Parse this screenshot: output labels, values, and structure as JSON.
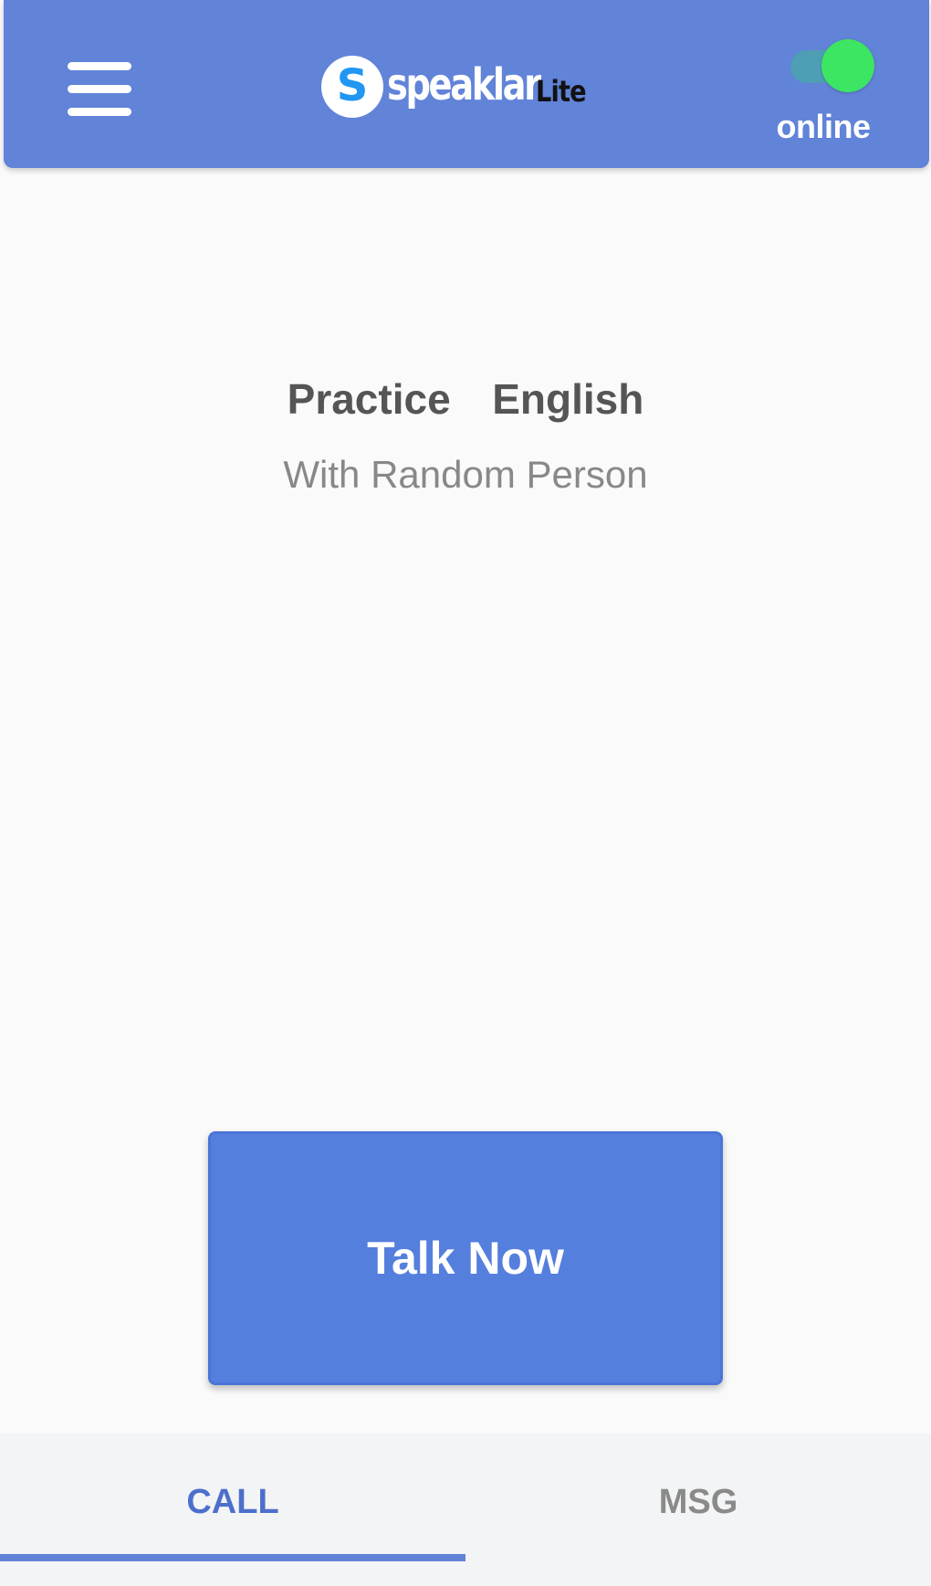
{
  "header": {
    "menu_icon": "hamburger-menu-icon",
    "logo": {
      "badge_letter": "S",
      "word": "speaklar",
      "suffix": "Lite"
    },
    "status": {
      "label": "online",
      "enabled": true,
      "track_color": "#4d9fb3",
      "knob_color": "#3ce562"
    },
    "background_color": "#6183d8"
  },
  "main": {
    "title": "Practice  English",
    "subtitle": "With Random Person",
    "primary_button": {
      "label": "Talk Now",
      "color": "#557fdd"
    }
  },
  "tabs": [
    {
      "label": "CALL",
      "active": true
    },
    {
      "label": "MSG",
      "active": false
    }
  ],
  "colors": {
    "accent": "#6183d8",
    "active_tab_text": "#4d6fcc",
    "inactive_tab_text": "#8a8a8a",
    "background": "#fafafa"
  }
}
